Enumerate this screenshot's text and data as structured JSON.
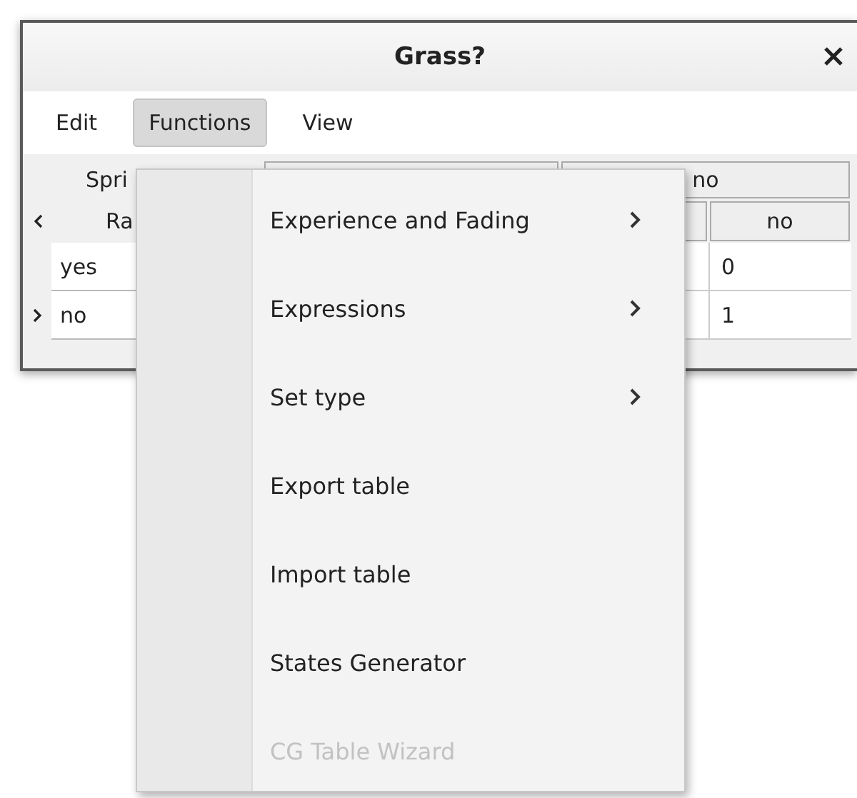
{
  "window": {
    "title": "Grass?"
  },
  "menubar": [
    {
      "label": "Edit",
      "selected": false
    },
    {
      "label": "Functions",
      "selected": true
    },
    {
      "label": "View",
      "selected": false
    }
  ],
  "table": {
    "parent_row": {
      "label": "Spri",
      "group_header": "no"
    },
    "child_row": {
      "label": "Ra",
      "column_header": "no"
    },
    "rows": [
      {
        "label": "yes",
        "value": "0"
      },
      {
        "label": "no",
        "value": "1"
      }
    ]
  },
  "context_menu": [
    {
      "label": "Experience and Fading",
      "submenu": true,
      "disabled": false
    },
    {
      "label": "Expressions",
      "submenu": true,
      "disabled": false
    },
    {
      "label": "Set type",
      "submenu": true,
      "disabled": false
    },
    {
      "label": "Export table",
      "submenu": false,
      "disabled": false
    },
    {
      "label": "Import table",
      "submenu": false,
      "disabled": false
    },
    {
      "label": "States Generator",
      "submenu": false,
      "disabled": false
    },
    {
      "label": "CG Table Wizard",
      "submenu": false,
      "disabled": true
    }
  ]
}
